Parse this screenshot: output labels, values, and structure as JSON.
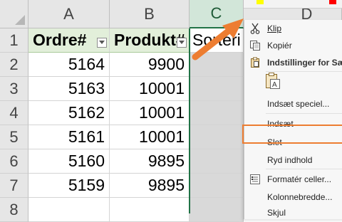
{
  "columns": [
    "A",
    "B",
    "C",
    "D"
  ],
  "rows": [
    "1",
    "2",
    "3",
    "4",
    "5",
    "6",
    "7",
    "8"
  ],
  "headers": {
    "a": "Ordre#",
    "b": "Produkt#",
    "c": "Sorteri"
  },
  "data": [
    {
      "ordre": "5164",
      "produkt": "9900"
    },
    {
      "ordre": "5163",
      "produkt": "10001"
    },
    {
      "ordre": "5162",
      "produkt": "10001"
    },
    {
      "ordre": "5161",
      "produkt": "10001"
    },
    {
      "ordre": "5160",
      "produkt": "9895"
    },
    {
      "ordre": "5159",
      "produkt": "9895"
    }
  ],
  "selected_column": "C",
  "context_menu": {
    "klip": "Klip",
    "kopier": "Kopiér",
    "paste_options": "Indstillinger for Sæt",
    "paste_special": "Indsæt speciel...",
    "insert": "Indsæt",
    "delete": "Slet",
    "clear": "Ryd indhold",
    "format": "Formatér celler...",
    "col_width": "Kolonnebredde...",
    "hide": "Skjul"
  },
  "colors": {
    "highlight": "#ed7d31",
    "excel_green": "#217346",
    "swatch_yellow": "#ffff00",
    "swatch_red": "#ff0000"
  },
  "icons": [
    "scissors-icon",
    "copy-icon",
    "clipboard-icon",
    "paste-values-icon",
    "format-cells-icon"
  ]
}
